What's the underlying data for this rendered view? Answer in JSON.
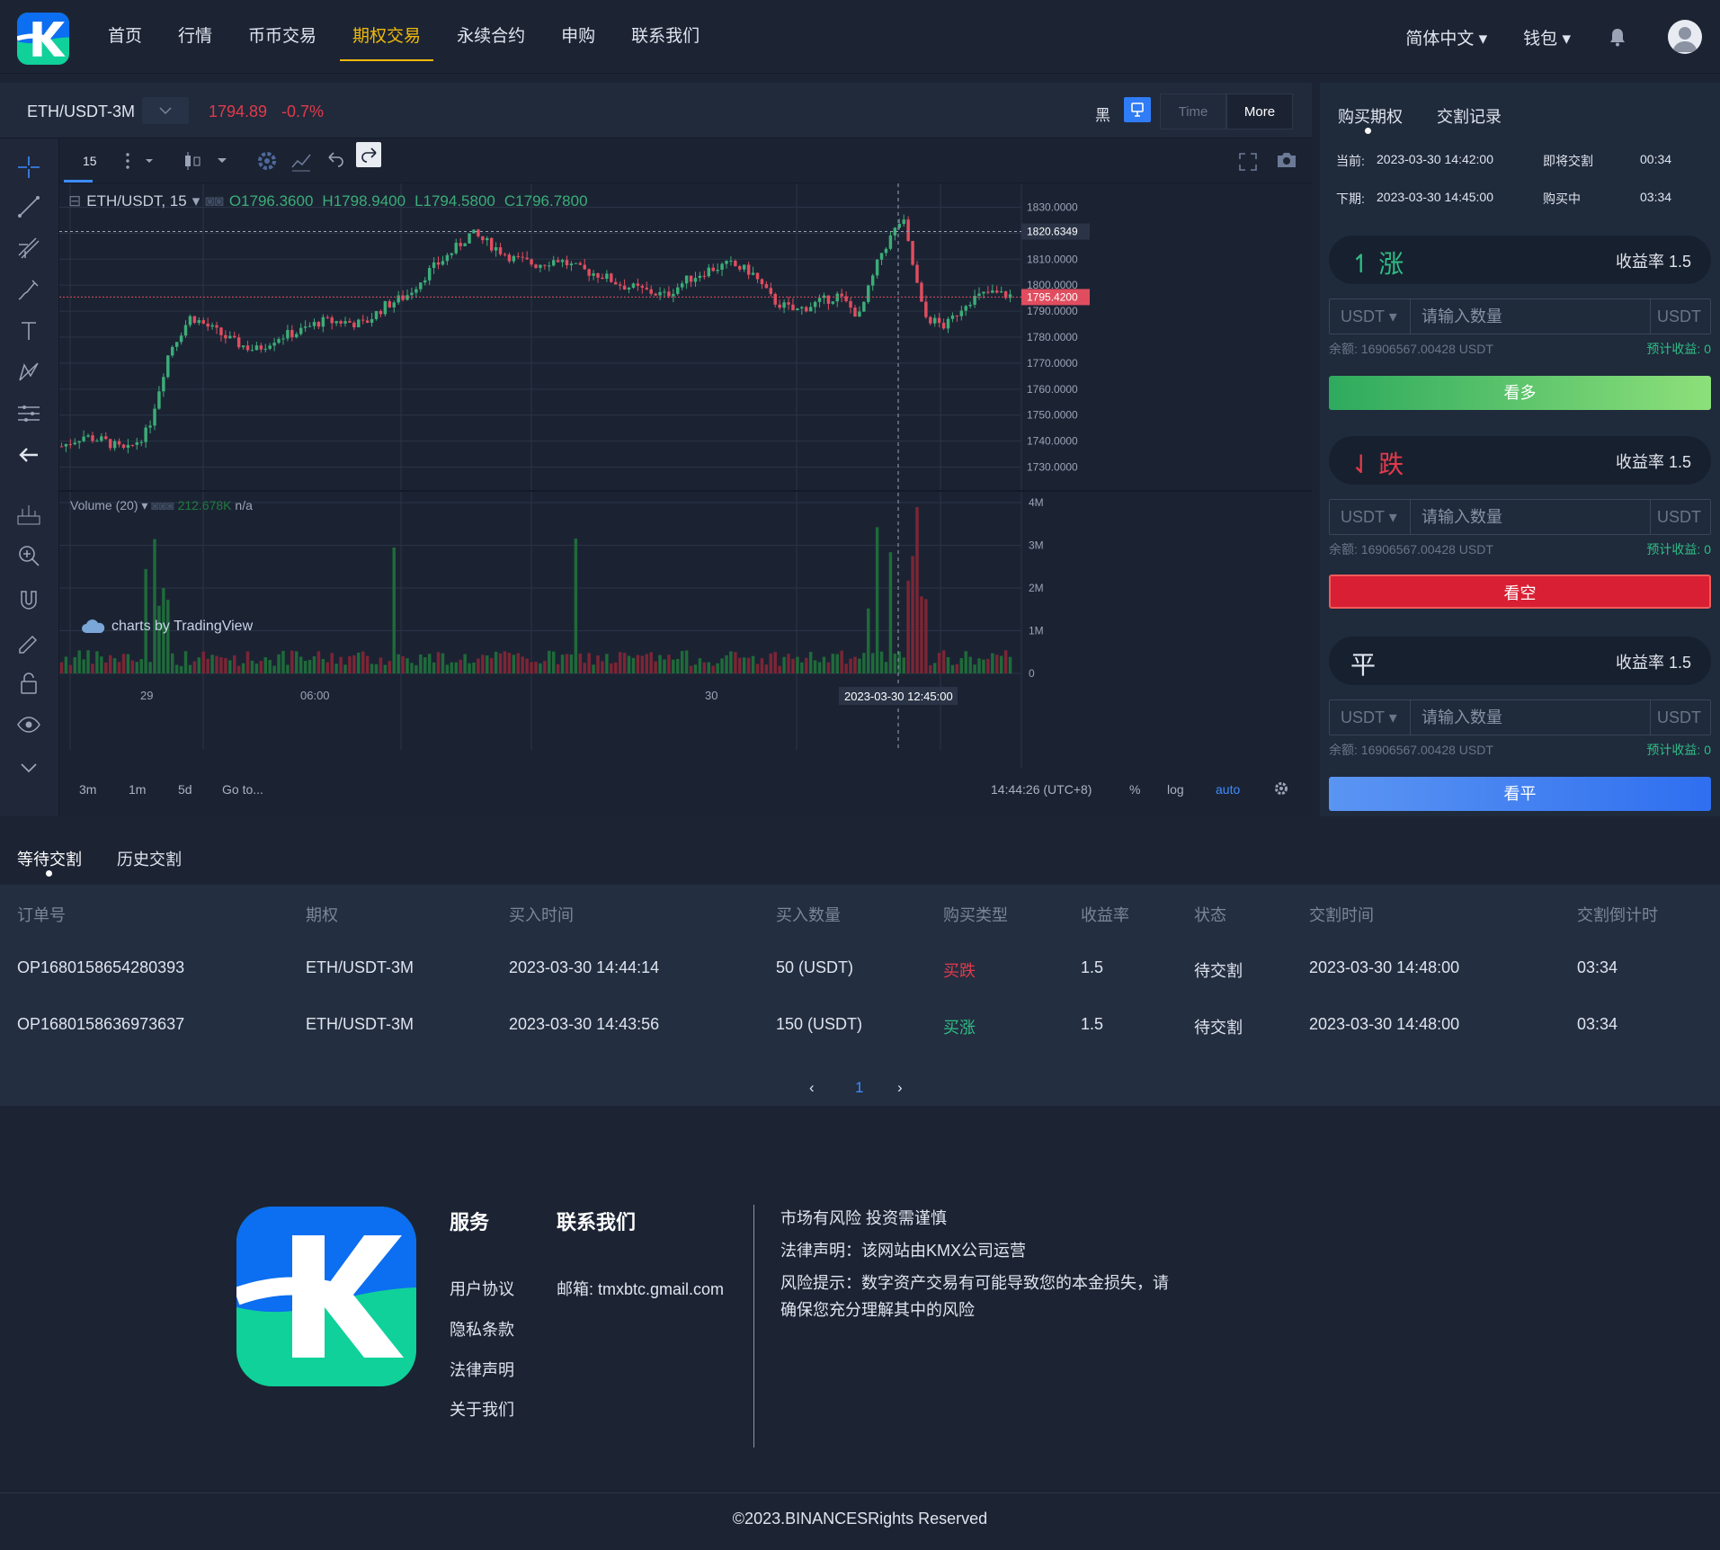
{
  "nav": {
    "items": [
      "首页",
      "行情",
      "币币交易",
      "期权交易",
      "永续合约",
      "申购",
      "联系我们"
    ],
    "active_index": 3,
    "language": "简体中文",
    "wallet": "钱包"
  },
  "chart_header": {
    "symbol": "ETH/USDT-3M",
    "price": "1794.89",
    "change": "-0.7%",
    "theme_label": "黑",
    "time_button": "Time",
    "more_button": "More"
  },
  "tradingview": {
    "interval": "15",
    "legend_symbol": "ETH/USDT, 15",
    "ohlc": {
      "o": "O1796.3600",
      "h": "H1798.9400",
      "l": "L1794.5800",
      "c": "C1796.7800"
    },
    "volume_label": "Volume (20)",
    "volume_value": "212.678K",
    "volume_na": "n/a",
    "watermark": "charts by TradingView",
    "price_ticks": [
      "1830.0000",
      "1820.0000",
      "1810.0000",
      "1800.0000",
      "1790.0000",
      "1780.0000",
      "1770.0000",
      "1760.0000",
      "1750.0000",
      "1740.0000",
      "1730.0000"
    ],
    "hi_marker": "1820.6349",
    "last_marker": "1795.4200",
    "vol_ticks": [
      "4M",
      "3M",
      "2M",
      "1M",
      "0"
    ],
    "time_ticks": [
      "29",
      "06:00",
      "30"
    ],
    "crosshair_time": "2023-03-30 12:45:00",
    "bottom_ranges": [
      "3m",
      "1m",
      "5d",
      "Go to..."
    ],
    "clock": "14:44:26 (UTC+8)",
    "pct": "%",
    "log": "log",
    "auto": "auto",
    "colors": {
      "up": "#3cad78",
      "down": "#e04d5f"
    }
  },
  "chart_data": {
    "type": "candlestick",
    "title": "ETH/USDT, 15",
    "ylim": [
      1725,
      1835
    ],
    "x_ticks": [
      "29",
      "06:00",
      "30"
    ],
    "candles_summary": {
      "open": 1738,
      "low": 1732,
      "high": 1828,
      "last": 1795.42,
      "approx_close_path": [
        1738,
        1742,
        1740,
        1736,
        1744,
        1775,
        1788,
        1783,
        1778,
        1775,
        1780,
        1782,
        1786,
        1786,
        1785,
        1792,
        1796,
        1805,
        1812,
        1820,
        1815,
        1810,
        1808,
        1810,
        1806,
        1804,
        1800,
        1798,
        1796,
        1802,
        1806,
        1808,
        1805,
        1794,
        1790,
        1793,
        1796,
        1788,
        1812,
        1826,
        1788,
        1784,
        1794,
        1797,
        1796
      ]
    },
    "volume_max": "4M"
  },
  "order_panel": {
    "tabs": [
      "购买期权",
      "交割记录"
    ],
    "current_label": "当前:",
    "current_time": "2023-03-30 14:42:00",
    "current_status": "即将交割",
    "current_countdown": "00:34",
    "next_label": "下期:",
    "next_time": "2023-03-30 14:45:00",
    "next_status": "购买中",
    "next_countdown": "03:34",
    "directions": [
      {
        "icon": "↿",
        "name": "涨",
        "rate": "收益率 1.5",
        "button": "看多",
        "color": "#2ebd85"
      },
      {
        "icon": "⇃",
        "name": "跌",
        "rate": "收益率 1.5",
        "button": "看空",
        "color": "#e23a4b"
      },
      {
        "icon": "",
        "name": "平",
        "rate": "收益率 1.5",
        "button": "看平",
        "color": "#dfe4ee"
      }
    ],
    "currency": "USDT",
    "placeholder": "请输入数量",
    "unit": "USDT",
    "balance": "余额:  16906567.00428 USDT",
    "estimate": "预计收益:  0"
  },
  "orders": {
    "tabs": [
      "等待交割",
      "历史交割"
    ],
    "headers": [
      "订单号",
      "期权",
      "买入时间",
      "买入数量",
      "购买类型",
      "收益率",
      "状态",
      "交割时间",
      "交割倒计时"
    ],
    "rows": [
      [
        "OP1680158654280393",
        "ETH/USDT-3M",
        "2023-03-30 14:44:14",
        "50 (USDT)",
        "买跌",
        "1.5",
        "待交割",
        "2023-03-30 14:48:00",
        "03:34"
      ],
      [
        "OP1680158636973637",
        "ETH/USDT-3M",
        "2023-03-30 14:43:56",
        "150 (USDT)",
        "买涨",
        "1.5",
        "待交割",
        "2023-03-30 14:48:00",
        "03:34"
      ]
    ],
    "page": "1",
    "prev": "‹",
    "next": "›"
  },
  "footer": {
    "services_title": "服务",
    "services": [
      "用户协议",
      "隐私条款",
      "法律声明",
      "关于我们"
    ],
    "contact_title": "联系我们",
    "email": "邮箱: tmxbtc.gmail.com",
    "notes": [
      "市场有风险 投资需谨慎",
      "法律声明：该网站由KMX公司运营",
      "风险提示：数字资产交易有可能导致您的本金损失，请确保您充分理解其中的风险"
    ],
    "copyright": "©2023.BINANCESRights Reserved"
  }
}
